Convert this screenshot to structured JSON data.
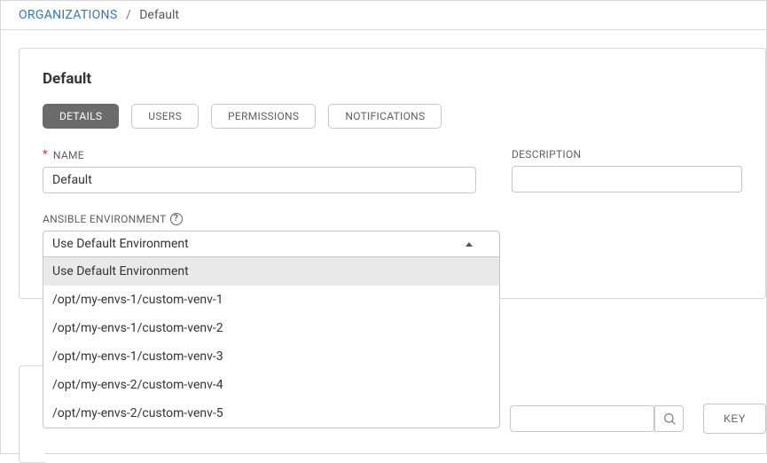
{
  "breadcrumb": {
    "root": "ORGANIZATIONS",
    "current": "Default"
  },
  "panel": {
    "title": "Default"
  },
  "tabs": {
    "details": "DETAILS",
    "users": "USERS",
    "permissions": "PERMISSIONS",
    "notifications": "NOTIFICATIONS"
  },
  "fields": {
    "name_label": "NAME",
    "name_value": "Default",
    "description_label": "DESCRIPTION",
    "description_value": "",
    "ansible_env_label": "ANSIBLE ENVIRONMENT",
    "ansible_env_value": "Use Default Environment"
  },
  "env_options": [
    "Use Default Environment",
    "/opt/my-envs-1/custom-venv-1",
    "/opt/my-envs-1/custom-venv-2",
    "/opt/my-envs-1/custom-venv-3",
    "/opt/my-envs-2/custom-venv-4",
    "/opt/my-envs-2/custom-venv-5"
  ],
  "toolbar": {
    "key_label": "KEY"
  }
}
